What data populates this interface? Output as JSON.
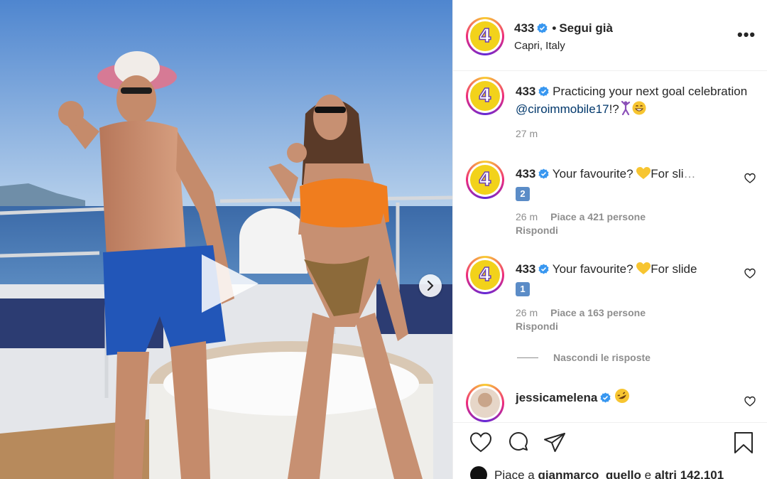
{
  "header": {
    "username": "433",
    "follow_status": "Segui già",
    "location": "Capri, Italy",
    "avatar_text": "4",
    "more_icon": "more-icon"
  },
  "caption": {
    "username": "433",
    "text": "Practicing your next goal celebration ",
    "mention": "@ciroimmobile17",
    "suffix": "!?",
    "time": "27 m"
  },
  "comments": [
    {
      "username": "433",
      "text": "Your favourite? ",
      "text2": "For sli",
      "ellipsis": "…",
      "key": "2",
      "time": "26 m",
      "likes": "Piace a 421 persone",
      "reply": "Rispondi"
    },
    {
      "username": "433",
      "text": "Your favourite? ",
      "text2": "For slide",
      "key": "1",
      "time": "26 m",
      "likes": "Piace a 163 persone",
      "reply": "Rispondi"
    }
  ],
  "hide_replies": "Nascondi le risposte",
  "reply_comment": {
    "username": "jessicamelena"
  },
  "likes_summary": {
    "prefix": "Piace a ",
    "user": "gianmarco_quello",
    "middle": " e ",
    "others": "altri 142.101"
  },
  "colors": {
    "text": "#262626",
    "secondary": "#8e8e8e",
    "mention": "#00376b",
    "verified": "#3897f0",
    "brand_yellow": "#f2d21b"
  }
}
